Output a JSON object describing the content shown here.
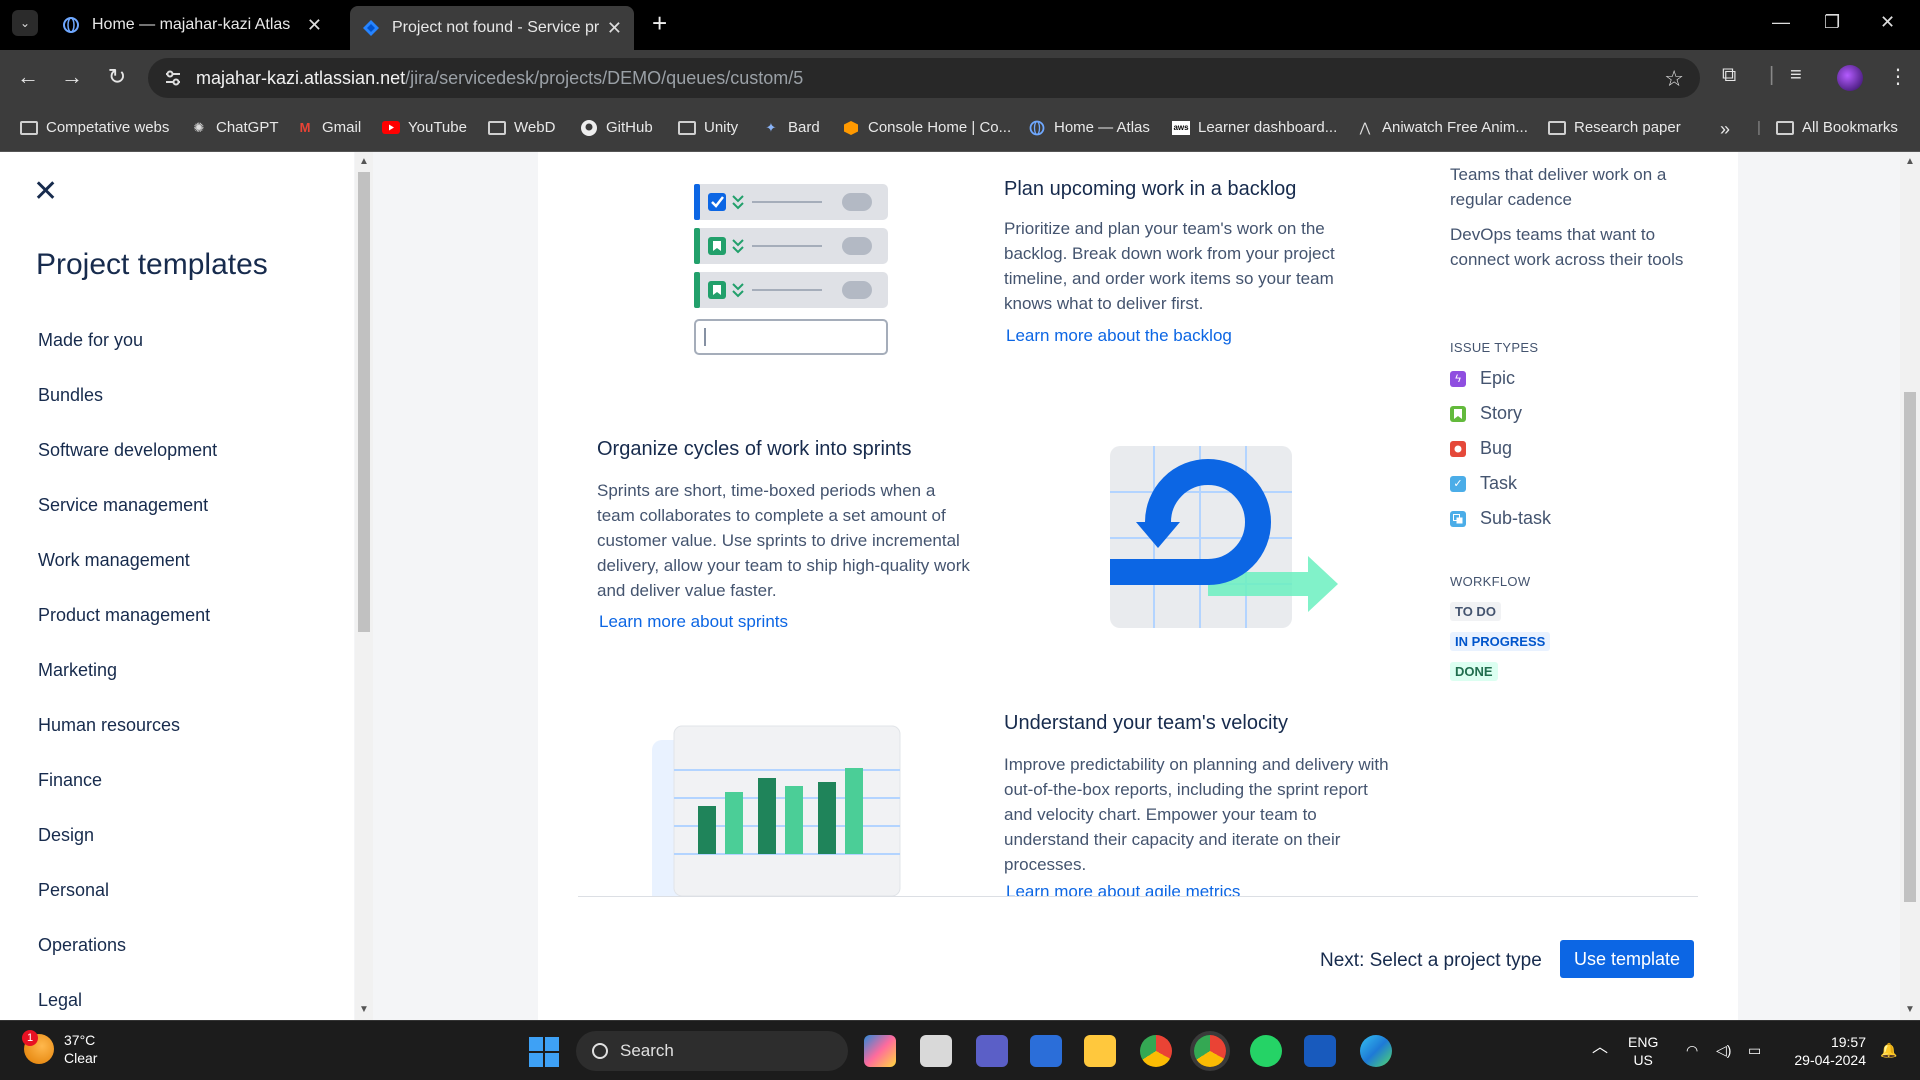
{
  "browser": {
    "tabs": [
      {
        "title": "Home — majahar-kazi Atlas",
        "active": false
      },
      {
        "title": "Project not found - Service proj",
        "active": true
      }
    ],
    "url_host": "majahar-kazi.atlassian.net",
    "url_path": "/jira/servicedesk/projects/DEMO/queues/custom/5",
    "bookmarks": [
      "Competative webs",
      "ChatGPT",
      "Gmail",
      "YouTube",
      "WebD",
      "GitHub",
      "Unity",
      "Bard",
      "Console Home | Co...",
      "Home — Atlas",
      "Learner dashboard...",
      "Aniwatch Free Anim...",
      "Research paper"
    ],
    "all_bookmarks": "All Bookmarks"
  },
  "sidebar": {
    "title": "Project templates",
    "items": [
      "Made for you",
      "Bundles",
      "Software development",
      "Service management",
      "Work management",
      "Product management",
      "Marketing",
      "Human resources",
      "Finance",
      "Design",
      "Personal",
      "Operations",
      "Legal"
    ]
  },
  "main": {
    "backlog": {
      "title": "Plan upcoming work in a backlog",
      "body": "Prioritize and plan your team's work on the backlog. Break down work from your project timeline, and order work items so your team knows what to deliver first.",
      "link": "Learn more about the backlog"
    },
    "sprints": {
      "title": "Organize cycles of work into sprints",
      "body": "Sprints are short, time-boxed periods when a team collaborates to complete a set amount of customer value. Use sprints to drive incremental delivery, allow your team to ship high-quality work and deliver value faster.",
      "link": "Learn more about sprints"
    },
    "velocity": {
      "title": "Understand your team's velocity",
      "body": "Improve predictability on planning and delivery with out-of-the-box reports, including the sprint report and velocity chart. Empower your team to understand their capacity and iterate on their processes.",
      "link": "Learn more about agile metrics"
    },
    "side": {
      "recommended_1": "Teams that deliver work on a regular cadence",
      "recommended_2": "DevOps teams that want to connect work across their tools",
      "issue_types_heading": "ISSUE TYPES",
      "issue_types": [
        {
          "label": "Epic",
          "color": "#8f4ee0"
        },
        {
          "label": "Story",
          "color": "#63ba3c"
        },
        {
          "label": "Bug",
          "color": "#e5493a"
        },
        {
          "label": "Task",
          "color": "#4bade8"
        },
        {
          "label": "Sub-task",
          "color": "#4bade8"
        }
      ],
      "workflow_heading": "WORKFLOW",
      "workflow": [
        {
          "label": "TO DO",
          "bg": "#f1f2f4",
          "fg": "#44546f"
        },
        {
          "label": "IN PROGRESS",
          "bg": "#e9f2ff",
          "fg": "#0055cc"
        },
        {
          "label": "DONE",
          "bg": "#dcfff1",
          "fg": "#216e4e"
        }
      ]
    },
    "footer": {
      "next_text": "Next: Select a project type",
      "button": "Use template"
    }
  },
  "taskbar": {
    "temperature": "37°C",
    "condition": "Clear",
    "weather_badge": "1",
    "search": "Search",
    "lang": "ENG",
    "region": "US",
    "time": "19:57",
    "date": "29-04-2024"
  }
}
